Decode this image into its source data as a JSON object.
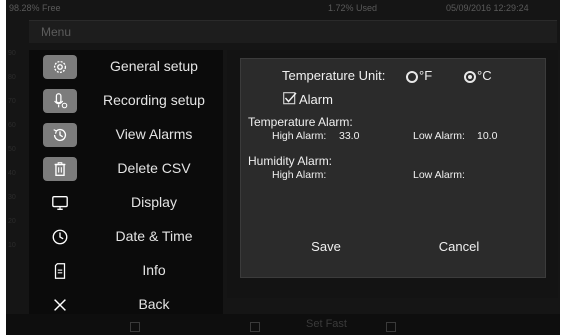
{
  "status": {
    "free": "98.28% Free",
    "used": "1.72% Used",
    "datetime": "05/09/2016 12:29:24"
  },
  "title": "Menu",
  "menu": [
    {
      "label": "General setup",
      "icon": "gear-icon"
    },
    {
      "label": "Recording setup",
      "icon": "microphone-settings-icon"
    },
    {
      "label": "View Alarms",
      "icon": "clock-history-icon"
    },
    {
      "label": "Delete CSV",
      "icon": "trash-icon"
    },
    {
      "label": "Display",
      "icon": "monitor-icon"
    },
    {
      "label": "Date & Time",
      "icon": "clock-icon"
    },
    {
      "label": "Info",
      "icon": "document-icon"
    },
    {
      "label": "Back",
      "icon": "close-icon"
    }
  ],
  "settings": {
    "temp_unit_label": "Temperature Unit:",
    "unit_f": "°F",
    "unit_c": "°C",
    "selected_unit": "°C",
    "alarm_label": "Alarm",
    "alarm_checked": true,
    "temp_alarm_label": "Temperature Alarm:",
    "temp_high_label": "High Alarm:",
    "temp_high_value": "33.0",
    "temp_low_label": "Low Alarm:",
    "temp_low_value": "10.0",
    "hum_alarm_label": "Humidity Alarm:",
    "hum_high_label": "High Alarm:",
    "hum_low_label": "Low Alarm:"
  },
  "buttons": {
    "save": "Save",
    "cancel": "Cancel"
  },
  "background_text": "Set Fast"
}
